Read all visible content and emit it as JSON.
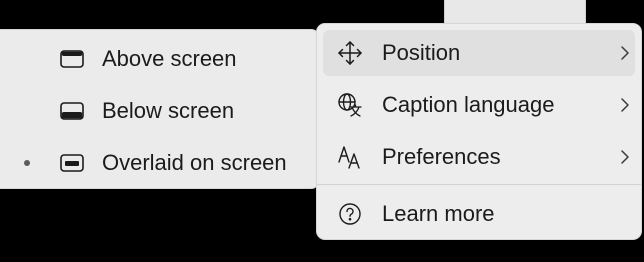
{
  "main_menu": {
    "items": [
      {
        "label": "Position",
        "icon": "move-arrows-icon",
        "has_submenu": true
      },
      {
        "label": "Caption language",
        "icon": "globe-translate-icon",
        "has_submenu": true
      },
      {
        "label": "Preferences",
        "icon": "text-size-icon",
        "has_submenu": true
      },
      {
        "label": "Learn more",
        "icon": "help-circle-icon",
        "has_submenu": false
      }
    ]
  },
  "submenu": {
    "items": [
      {
        "label": "Above screen",
        "icon": "panel-top-icon",
        "selected": false
      },
      {
        "label": "Below screen",
        "icon": "panel-bottom-icon",
        "selected": false
      },
      {
        "label": "Overlaid on screen",
        "icon": "panel-overlay-icon",
        "selected": true
      }
    ]
  },
  "colors": {
    "menu_bg": "#ededed",
    "hover_bg": "#e0e0e0",
    "text": "#1b1b1b",
    "backdrop": "#000000"
  }
}
